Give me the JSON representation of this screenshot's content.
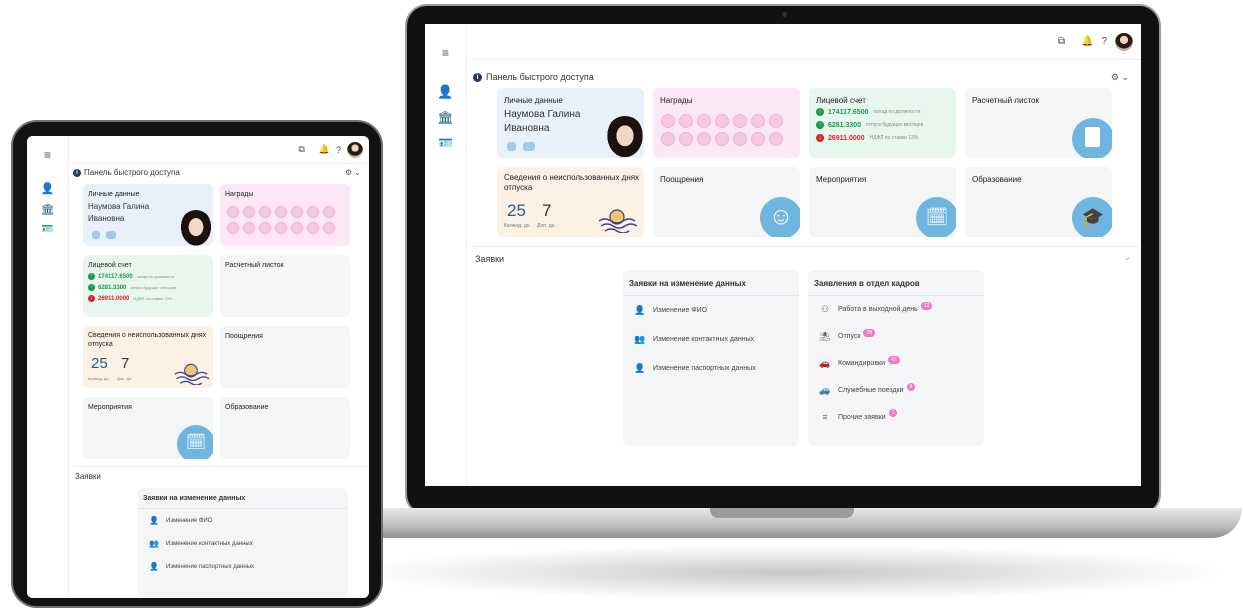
{
  "panel": {
    "title": "Панель быстрого доступа"
  },
  "cards": {
    "personal": {
      "title": "Личные данные",
      "name_line1": "Наумова Галина",
      "name_line2": "Ивановна"
    },
    "awards": {
      "title": "Награды"
    },
    "account": {
      "title": "Лицевой счет",
      "rows": [
        {
          "value": "174117.6500",
          "note": "оклад по должности",
          "dir": "up"
        },
        {
          "value": "6281.3300",
          "note": "отпуск будущих месяцев",
          "dir": "up"
        },
        {
          "value": "26911.0000",
          "note": "НДФЛ по ставке 13%",
          "dir": "down"
        }
      ]
    },
    "payslip": {
      "title": "Расчетный листок"
    },
    "vacation": {
      "title": "Сведения о неиспользованных днях отпуска",
      "calendar_days": "25",
      "extra_days": "7",
      "calendar_label": "Календ. дн.",
      "extra_label": "Доп. дн."
    },
    "rewards": {
      "title": "Поощрения"
    },
    "events": {
      "title": "Мероприятия"
    },
    "education": {
      "title": "Образование"
    }
  },
  "requests": {
    "title": "Заявки",
    "data_change": {
      "title": "Заявки на изменение данных",
      "items": [
        "Изменение ФИО",
        "Изменение контактных данных",
        "Изменение паспортных данных"
      ]
    },
    "hr": {
      "title": "Заявления в отдел кадров",
      "items": [
        {
          "label": "Работа в выходной день",
          "count": "12"
        },
        {
          "label": "Отпуск",
          "count": "28"
        },
        {
          "label": "Командировки",
          "count": "47"
        },
        {
          "label": "Служебные поездки",
          "count": "9"
        },
        {
          "label": "Прочие заявки",
          "count": "1"
        }
      ]
    }
  },
  "colors": {
    "accent": "#1f5f87",
    "icon_blue": "#6fb5df",
    "positive": "#1a9a4a",
    "negative": "#e0202a",
    "badge": "#f07ac0"
  }
}
